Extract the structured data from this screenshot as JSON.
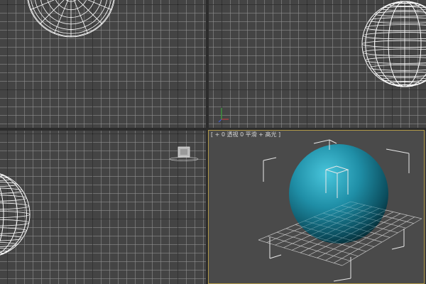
{
  "viewports": {
    "top_left": {
      "shading": "wireframe"
    },
    "top_right": {
      "shading": "wireframe"
    },
    "bottom_left": {
      "shading": "wireframe"
    },
    "perspective": {
      "label": "[ + 0 透视 0 平滑 + 高光 ]",
      "active": true,
      "shading": "smooth + highlights"
    }
  },
  "colors": {
    "viewport_bg": "#444444",
    "grid_minor": "#8a8a8a",
    "grid_major": "#1e1e1e",
    "wire_white": "#ffffff",
    "sphere_teal": "#1f8ea6",
    "active_border": "#b29a48",
    "axis_x": "#d04040",
    "axis_y": "#40c040",
    "axis_z": "#4060e0"
  },
  "icons": [
    "axis-tripod-icon",
    "camera-gizmo-icon"
  ]
}
